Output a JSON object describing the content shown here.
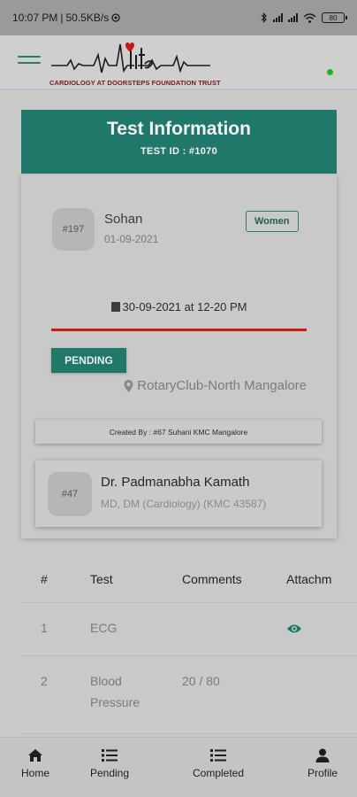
{
  "status_bar": {
    "time": "10:07 PM",
    "network_speed": "50.5KB/s",
    "battery": "80"
  },
  "app": {
    "logo_tagline": "CARDIOLOGY AT DOORSTEPS FOUNDATION TRUST",
    "accent_color": "#20786b",
    "online_color": "#1fb51f"
  },
  "header": {
    "title": "Test Information",
    "test_id": "TEST ID : #1070"
  },
  "patient": {
    "id": "#197",
    "name": "Sohan",
    "date": "01-09-2021",
    "category": "Women"
  },
  "schedule": "30-09-2021 at 12-20 PM",
  "status": "PENDING",
  "location": "RotaryClub-North Mangalore",
  "created_by": "Created By : #67 Suhani KMC Mangalore",
  "doctor": {
    "id": "#47",
    "name": "Dr. Padmanabha Kamath",
    "qualification": "MD, DM (Cardiology) (KMC 43587)"
  },
  "tests_table": {
    "columns": [
      "#",
      "Test",
      "Comments",
      "Attachm"
    ],
    "rows": [
      {
        "num": "1",
        "test": "ECG",
        "comment": "",
        "attachment_icon": "eye-icon"
      },
      {
        "num": "2",
        "test": "Blood\nPressure",
        "comment": "20 / 80",
        "attachment_icon": ""
      }
    ]
  },
  "bottom_nav": {
    "items": [
      {
        "label": "Home",
        "icon": "home-icon"
      },
      {
        "label": "Pending",
        "icon": "list-icon"
      },
      {
        "label": "Completed",
        "icon": "list-icon"
      },
      {
        "label": "Profile",
        "icon": "person-icon"
      }
    ]
  }
}
